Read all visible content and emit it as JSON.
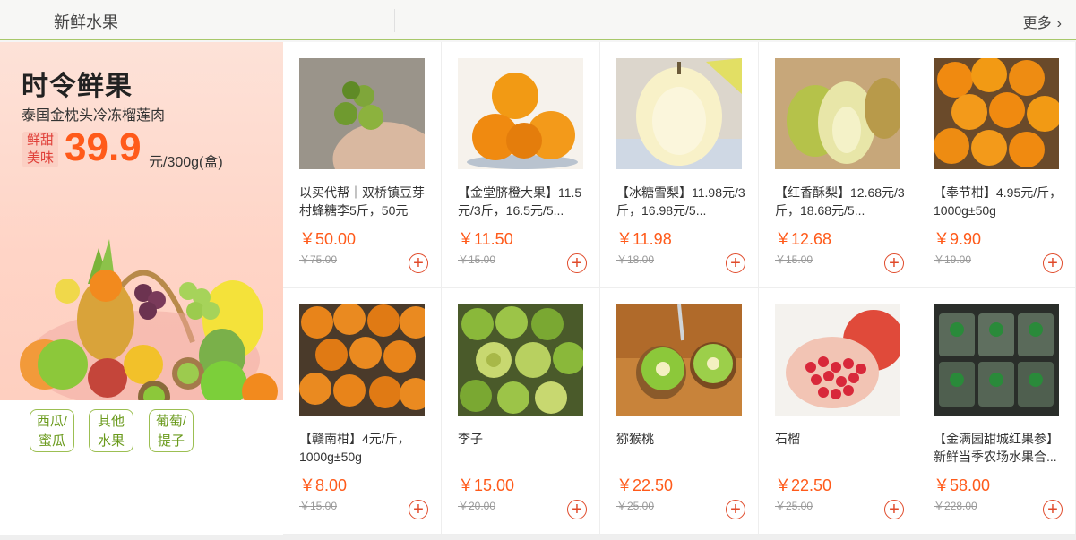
{
  "header": {
    "title": "新鲜水果",
    "more": "更多"
  },
  "promo": {
    "title": "时令鲜果",
    "subtitle": "泰国金枕头冷冻榴莲肉",
    "tag_line1": "鲜甜",
    "tag_line2": "美味",
    "price": "39.9",
    "unit": "元/300g(盒)"
  },
  "categories": [
    {
      "line1": "西瓜/",
      "line2": "蜜瓜"
    },
    {
      "line1": "其他",
      "line2": "水果"
    },
    {
      "line1": "葡萄/",
      "line2": "提子"
    }
  ],
  "products": [
    {
      "name": "以买代帮｜双桥镇豆芽村蜂糖李5斤，50元",
      "price": "￥50.00",
      "old": "￥75.00",
      "icon": "green-plum-photo"
    },
    {
      "name": "【金堂脐橙大果】11.5元/3斤，16.5元/5...",
      "price": "￥11.50",
      "old": "￥15.00",
      "icon": "navel-orange-photo"
    },
    {
      "name": "【冰糖雪梨】11.98元/3斤，16.98元/5...",
      "price": "￥11.98",
      "old": "￥18.00",
      "icon": "snow-pear-photo"
    },
    {
      "name": "【红香酥梨】12.68元/3斤，18.68元/5...",
      "price": "￥12.68",
      "old": "￥15.00",
      "icon": "red-pear-photo"
    },
    {
      "name": "【奉节柑】4.95元/斤，1000g±50g",
      "price": "￥9.90",
      "old": "￥19.00",
      "icon": "orange-pile-photo"
    },
    {
      "name": "【赣南柑】4元/斤，1000g±50g",
      "price": "￥8.00",
      "old": "￥15.00",
      "icon": "tangerine-photo"
    },
    {
      "name": "李子",
      "price": "￥15.00",
      "old": "￥20.00",
      "icon": "plum-photo"
    },
    {
      "name": "猕猴桃",
      "price": "￥22.50",
      "old": "￥25.00",
      "icon": "kiwi-photo"
    },
    {
      "name": "石榴",
      "price": "￥22.50",
      "old": "￥25.00",
      "icon": "pomegranate-photo"
    },
    {
      "name": "【金满园甜城红果参】新鲜当季农场水果合...",
      "price": "￥58.00",
      "old": "￥228.00",
      "icon": "packed-fruit-photo"
    }
  ],
  "colors": {
    "accent": "#ff5a1a",
    "green": "#9cbf52",
    "add_button": "#e04a2a"
  }
}
